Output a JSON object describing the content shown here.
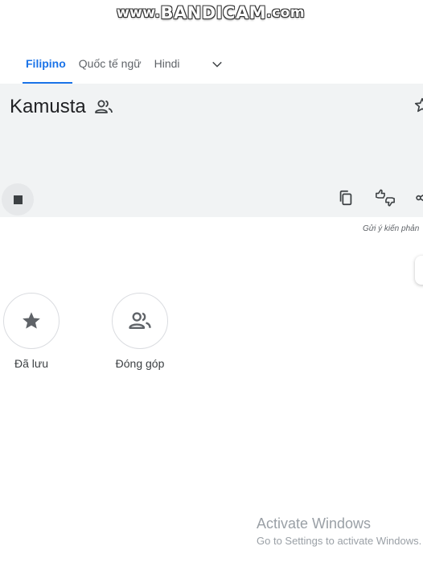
{
  "watermark": {
    "prefix": "www.",
    "brand": "BANDICAM",
    "suffix": ".com"
  },
  "tabs": [
    {
      "label": "Filipino",
      "active": true
    },
    {
      "label": "Quốc tế ngữ",
      "active": false
    },
    {
      "label": "Hindi",
      "active": false
    }
  ],
  "result": {
    "text": "Kamusta"
  },
  "feedback_link": "Gửi ý kiến phản",
  "saved": {
    "label": "Đã lưu"
  },
  "contribute": {
    "label": "Đóng góp"
  },
  "activation": {
    "title": "Activate Windows",
    "subtitle": "Go to Settings to activate Windows."
  },
  "colors": {
    "accent": "#1a73e8",
    "card_bg": "#f1f3f4",
    "icon": "#5f6368"
  },
  "icons": [
    "people-icon",
    "star-outline-icon",
    "stop-icon",
    "copy-icon",
    "feedback-icon",
    "share-icon",
    "star-filled-icon",
    "people-outline-icon",
    "chevron-down-icon"
  ]
}
